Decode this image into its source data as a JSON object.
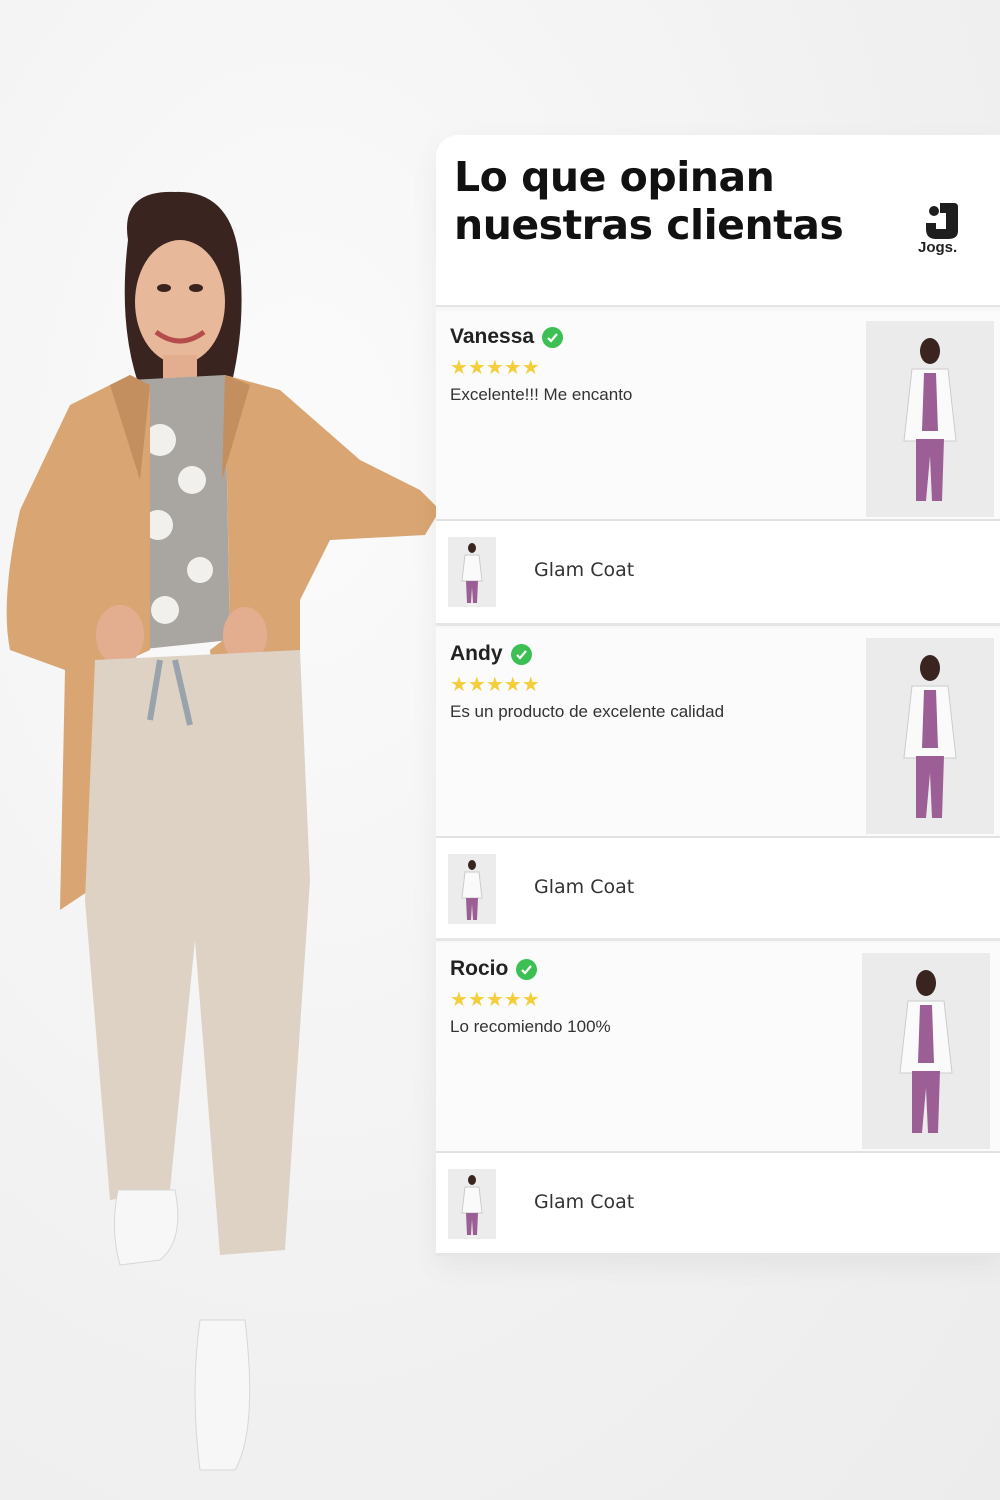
{
  "header": {
    "title": "Lo que opinan nuestras clientas",
    "logo_text": "Jogs."
  },
  "reviews": [
    {
      "name": "Vanessa",
      "rating": 5,
      "stars": "★★★★★",
      "comment": "Excelente!!! Me encanto",
      "product": "Glam Coat"
    },
    {
      "name": "Andy",
      "rating": 5,
      "stars": "★★★★★",
      "comment": "Es un producto de excelente calidad",
      "product": "Glam Coat"
    },
    {
      "name": "Rocio",
      "rating": 5,
      "stars": "★★★★★",
      "comment": "Lo recomiendo 100%",
      "product": "Glam Coat"
    }
  ],
  "colors": {
    "verified": "#3cc054",
    "stars": "#f4ce3a",
    "coat": "#d9a673",
    "pants": "#ddd2c3"
  }
}
